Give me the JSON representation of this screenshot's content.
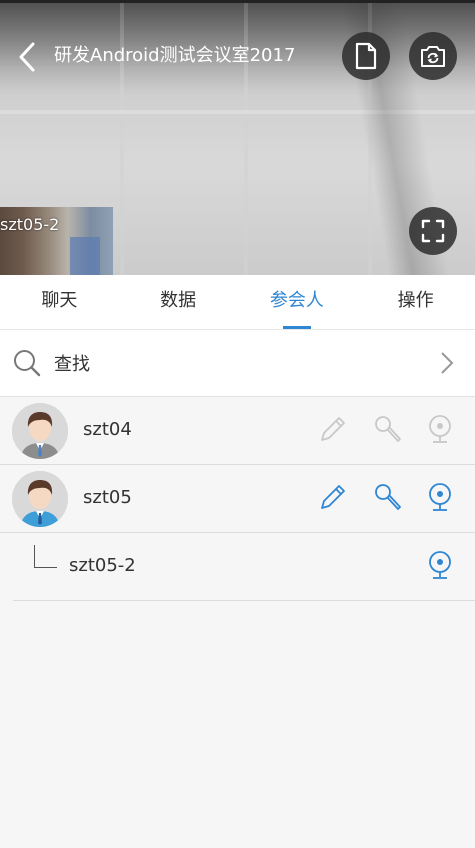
{
  "header": {
    "title": "研发Android测试会议室2017",
    "back_icon": "back-arrow-icon",
    "document_icon": "document-icon",
    "camera_switch_icon": "camera-switch-icon",
    "fullscreen_icon": "fullscreen-icon"
  },
  "video": {
    "thumbnail_label": "szt05-2"
  },
  "tabs": [
    {
      "label": "聊天",
      "active": false
    },
    {
      "label": "数据",
      "active": false
    },
    {
      "label": "参会人",
      "active": true
    },
    {
      "label": "操作",
      "active": false
    }
  ],
  "search": {
    "label": "查找",
    "icon": "search-icon"
  },
  "participants": [
    {
      "name": "szt04",
      "active": false
    },
    {
      "name": "szt05",
      "active": true
    },
    {
      "name": "szt05-2",
      "active": true,
      "sub": true
    }
  ],
  "colors": {
    "accent": "#2f86d3",
    "inactive_icon": "#c8c8c8",
    "text": "#333333"
  }
}
